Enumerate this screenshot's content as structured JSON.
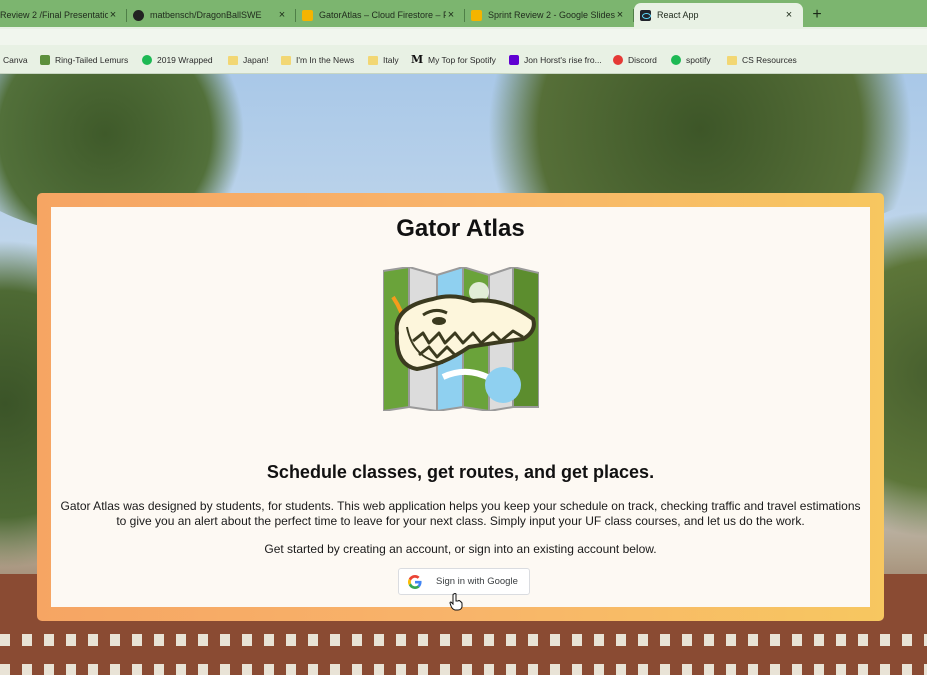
{
  "browser": {
    "tabs": [
      {
        "title": "Review 2 /Final Presentatio",
        "favicon": "slides-icon",
        "active": false
      },
      {
        "title": "matbensch/DragonBallSWE",
        "favicon": "github-icon",
        "active": false
      },
      {
        "title": "GatorAtlas – Cloud Firestore – Fi",
        "favicon": "firebase-icon",
        "active": false
      },
      {
        "title": "Sprint Review 2 - Google Slides",
        "favicon": "slides-icon",
        "active": false
      },
      {
        "title": "React App",
        "favicon": "react-icon",
        "active": true
      }
    ],
    "new_tab_symbol": "+",
    "close_symbol": "×",
    "bookmarks": [
      {
        "label": "Canva",
        "icon": "canva-icon"
      },
      {
        "label": "Ring-Tailed Lemurs",
        "icon": "lemur-icon"
      },
      {
        "label": "2019 Wrapped",
        "icon": "spotify-icon"
      },
      {
        "label": "Japan!",
        "icon": "folder-icon"
      },
      {
        "label": "I'm In the News",
        "icon": "folder-icon"
      },
      {
        "label": "Italy",
        "icon": "folder-icon"
      },
      {
        "label": "My Top for Spotify",
        "icon": "medium-icon"
      },
      {
        "label": "Jon Horst's rise fro...",
        "icon": "yahoo-icon"
      },
      {
        "label": "Discord",
        "icon": "discord-icon"
      },
      {
        "label": "spotify",
        "icon": "spotify-icon"
      },
      {
        "label": "CS Resources",
        "icon": "folder-icon"
      }
    ]
  },
  "card": {
    "title": "Gator Atlas",
    "headline": "Schedule classes, get routes, and get places.",
    "description": "Gator Atlas was designed by students, for students. This web application helps you keep your schedule on track, checking traffic and travel estimations to give you an alert about the perfect time to leave for your next class. Simply input your UF class courses, and let us do the work.",
    "cta": "Get started by creating an account, or sign into an existing account below.",
    "google_button_label": "Sign in with Google"
  },
  "colors": {
    "tabbar": "#7cb56f",
    "card_border_start": "#f6a563",
    "card_border_end": "#f7c760",
    "card_bg": "#fdf9f3"
  }
}
